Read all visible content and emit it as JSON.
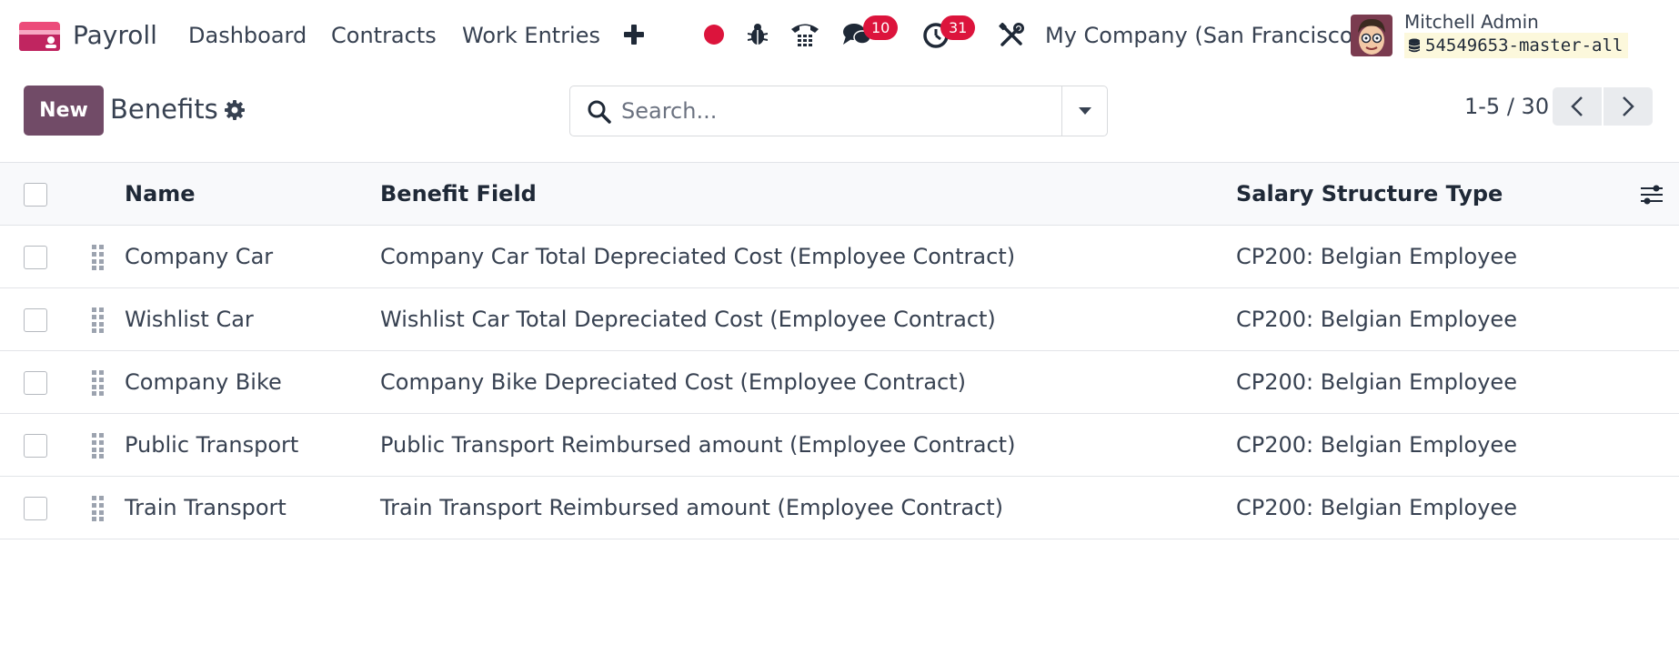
{
  "navbar": {
    "app_name": "Payroll",
    "menu": [
      "Dashboard",
      "Contracts",
      "Work Entries"
    ],
    "messages_badge": "10",
    "activities_badge": "31",
    "company": "My Company (San Francisco)",
    "user_name": "Mitchell Admin",
    "database": "54549653-master-all"
  },
  "control": {
    "new_label": "New",
    "title": "Benefits",
    "search_placeholder": "Search...",
    "pager": "1-5 / 30"
  },
  "table": {
    "headers": {
      "name": "Name",
      "field": "Benefit Field",
      "type": "Salary Structure Type"
    },
    "rows": [
      {
        "name": "Company Car",
        "field": "Company Car Total Depreciated Cost (Employee Contract)",
        "type": "CP200: Belgian Employee"
      },
      {
        "name": "Wishlist Car",
        "field": "Wishlist Car Total Depreciated Cost (Employee Contract)",
        "type": "CP200: Belgian Employee"
      },
      {
        "name": "Company Bike",
        "field": "Company Bike Depreciated Cost (Employee Contract)",
        "type": "CP200: Belgian Employee"
      },
      {
        "name": "Public Transport",
        "field": "Public Transport Reimbursed amount (Employee Contract)",
        "type": "CP200: Belgian Employee"
      },
      {
        "name": "Train Transport",
        "field": "Train Transport Reimbursed amount (Employee Contract)",
        "type": "CP200: Belgian Employee"
      }
    ]
  },
  "colors": {
    "brand": "#714b67",
    "badge": "#dc143c",
    "db_chip_bg": "#fcf8dc"
  },
  "icons": [
    "payroll-app-icon",
    "plus-icon",
    "recording-dot-icon",
    "bug-icon",
    "phone-icon",
    "chat-icon",
    "clock-icon",
    "tools-icon",
    "gear-icon",
    "search-icon",
    "caret-down-icon",
    "chevron-left-icon",
    "chevron-right-icon",
    "drag-handle-icon",
    "optional-columns-icon",
    "database-icon"
  ]
}
